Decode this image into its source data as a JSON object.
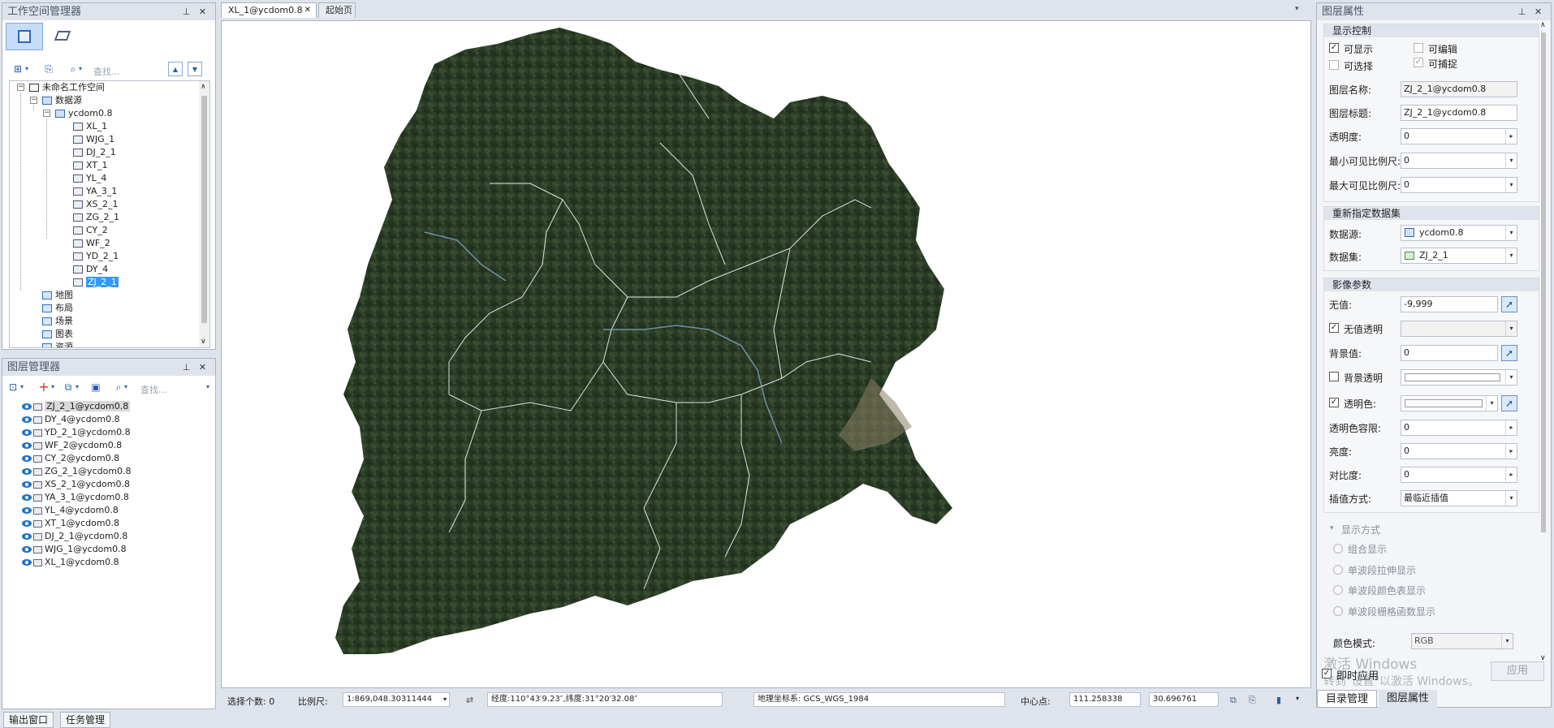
{
  "workspace_manager": {
    "title": "工作空间管理器",
    "search_placeholder": "查找...",
    "tree": {
      "root": "未命名工作空间",
      "datasources": "数据源",
      "datasource": "ycdom0.8",
      "datasets": [
        "XL_1",
        "WJG_1",
        "DJ_2_1",
        "XT_1",
        "YL_4",
        "YA_3_1",
        "XS_2_1",
        "ZG_2_1",
        "CY_2",
        "WF_2",
        "YD_2_1",
        "DY_4",
        "ZJ_2_1"
      ],
      "maps": "地图",
      "layouts": "布局",
      "scenes": "场景",
      "charts": "图表",
      "resources": "资源"
    }
  },
  "layer_manager": {
    "title": "图层管理器",
    "search_placeholder": "查找...",
    "layers": [
      "ZJ_2_1@ycdom0.8",
      "DY_4@ycdom0.8",
      "YD_2_1@ycdom0.8",
      "WF_2@ycdom0.8",
      "CY_2@ycdom0.8",
      "ZG_2_1@ycdom0.8",
      "XS_2_1@ycdom0.8",
      "YA_3_1@ycdom0.8",
      "YL_4@ycdom0.8",
      "XT_1@ycdom0.8",
      "DJ_2_1@ycdom0.8",
      "WJG_1@ycdom0.8",
      "XL_1@ycdom0.8"
    ]
  },
  "tabs": {
    "active": "XL_1@ycdom0.8",
    "close": "✕",
    "start": "起始页"
  },
  "status_bar": {
    "selection_label": "选择个数: 0",
    "scale_label": "比例尺:",
    "scale_value": "1:869,048.30311444",
    "coords": "经度:110°43′9.23″,纬度:31°20′32.08″",
    "crs": "地理坐标系: GCS_WGS_1984",
    "center_label": "中心点:",
    "center_x": "111.258338",
    "center_y": "30.696761"
  },
  "bottom_tabs": [
    "输出窗口",
    "任务管理"
  ],
  "layer_properties": {
    "title": "图层属性",
    "display_control": {
      "title": "显示控制",
      "visible": "可显示",
      "editable": "可编辑",
      "selectable": "可选择",
      "snappable": "可捕捉",
      "layer_name_label": "图层名称:",
      "layer_name": "ZJ_2_1@ycdom0.8",
      "layer_caption_label": "图层标题:",
      "layer_caption": "ZJ_2_1@ycdom0.8",
      "transparency_label": "透明度:",
      "transparency": "0",
      "min_scale_label": "最小可见比例尺:",
      "min_scale": "0",
      "max_scale_label": "最大可见比例尺:",
      "max_scale": "0"
    },
    "reassign": {
      "title": "重新指定数据集",
      "datasource_label": "数据源:",
      "datasource": "ycdom0.8",
      "dataset_label": "数据集:",
      "dataset": "ZJ_2_1"
    },
    "image_params": {
      "title": "影像参数",
      "nodata_label": "无值:",
      "nodata": "-9,999",
      "nodata_transparent": "无值透明",
      "background_label": "背景值:",
      "background": "0",
      "background_transparent": "背景透明",
      "transparent_color": "透明色:",
      "tolerance_label": "透明色容限:",
      "tolerance": "0",
      "brightness_label": "亮度:",
      "brightness": "0",
      "contrast_label": "对比度:",
      "contrast": "0",
      "interp_label": "插值方式:",
      "interp": "最临近插值"
    },
    "display_mode": {
      "title": "显示方式",
      "options": [
        "组合显示",
        "单波段拉伸显示",
        "单波段颜色表显示",
        "单波段栅格函数显示"
      ],
      "color_mode_label": "颜色模式:",
      "color_mode": "RGB"
    },
    "instant_apply": "即时应用",
    "apply": "应用",
    "watermark_line1": "激活 Windows",
    "watermark_line2": "转到\"设置\"以激活 Windows。",
    "tabs": [
      "目录管理",
      "图层属性"
    ]
  },
  "colors": {
    "accent": "#3399ff",
    "panel_header": "#dfe4ec",
    "map_dark": "#24331f"
  }
}
